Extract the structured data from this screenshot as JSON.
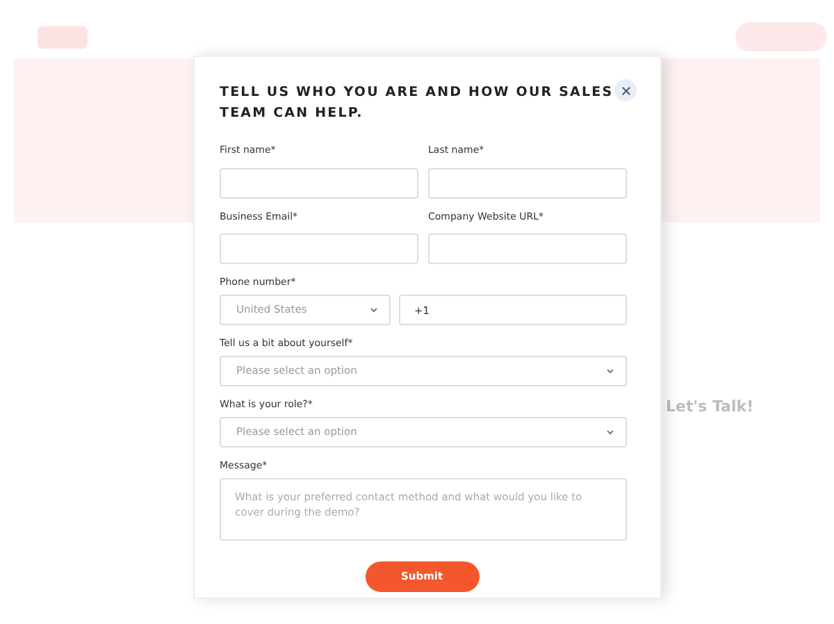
{
  "background": {
    "heading": "Let's Talk!"
  },
  "dialog": {
    "title": "TELL US WHO YOU ARE AND HOW OUR SALES TEAM CAN HELP.",
    "fields": [
      {
        "kind": "text",
        "label": "First name*"
      },
      {
        "kind": "text",
        "label": "Last name*"
      },
      {
        "kind": "text",
        "label": "Business Email*"
      },
      {
        "kind": "text",
        "label": "Company Website URL*"
      },
      {
        "kind": "phone",
        "label": "Phone number*",
        "country": "United States",
        "value": "+1"
      },
      {
        "kind": "select",
        "label": "Tell us a bit about yourself*",
        "placeholder": "Please select an option"
      },
      {
        "kind": "select",
        "label": "What is your role?*",
        "placeholder": "Please select an option"
      },
      {
        "kind": "textarea",
        "label": "Message*",
        "placeholder": "What is your preferred contact method and what would you like to cover during the demo?"
      }
    ],
    "submit": "Submit"
  }
}
